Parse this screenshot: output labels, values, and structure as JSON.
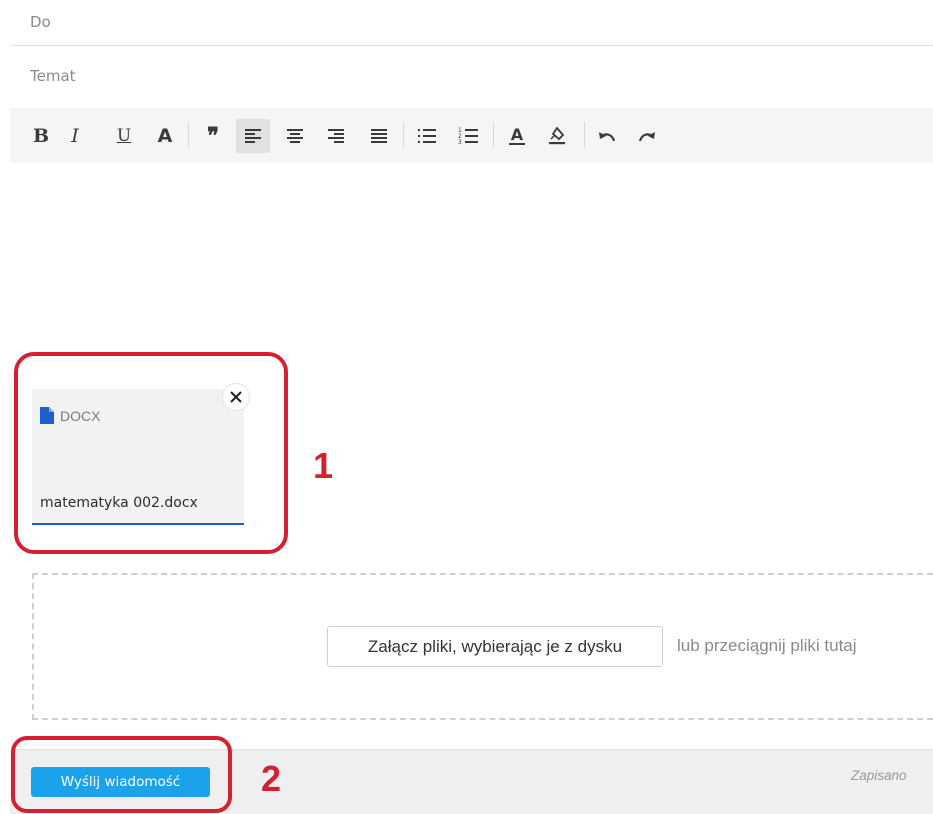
{
  "compose": {
    "to": {
      "value": "",
      "placeholder": "Do"
    },
    "subject": {
      "value": "",
      "placeholder": "Temat"
    }
  },
  "toolbar": {
    "buttons": [
      {
        "name": "bold",
        "icon": "bold-icon",
        "glyph": "B"
      },
      {
        "name": "italic",
        "icon": "italic-icon",
        "glyph": "I"
      },
      {
        "name": "underline",
        "icon": "underline-icon",
        "glyph": "U"
      },
      {
        "name": "font-color",
        "icon": "font-icon",
        "glyph": "A"
      },
      {
        "name": "blockquote",
        "icon": "quote-icon",
        "glyph": "❞"
      },
      {
        "name": "align-left",
        "icon": "align-left-icon",
        "active": true
      },
      {
        "name": "align-center",
        "icon": "align-center-icon"
      },
      {
        "name": "align-right",
        "icon": "align-right-icon"
      },
      {
        "name": "justify",
        "icon": "align-justify-icon"
      },
      {
        "name": "bullet-list",
        "icon": "bullet-list-icon"
      },
      {
        "name": "numbered-list",
        "icon": "numbered-list-icon"
      },
      {
        "name": "text-color",
        "icon": "text-color-icon",
        "glyph": "A"
      },
      {
        "name": "highlight",
        "icon": "highlight-icon"
      },
      {
        "name": "undo",
        "icon": "undo-icon"
      },
      {
        "name": "redo",
        "icon": "redo-icon"
      }
    ]
  },
  "attachment": {
    "type": "DOCX",
    "filename": "matematyka 002.docx",
    "icon": "file-icon",
    "icon_color": "#1e5fcc"
  },
  "upload": {
    "button_label": "Załącz pliki, wybierając je z dysku",
    "hint": "lub przeciągnij pliki tutaj"
  },
  "annotations": {
    "marker_1": "1",
    "marker_2": "2",
    "color": "#d42030"
  },
  "footer": {
    "send_label": "Wyślij wiadomość",
    "status": "Zapisano",
    "send_color": "#1aa3ea"
  }
}
